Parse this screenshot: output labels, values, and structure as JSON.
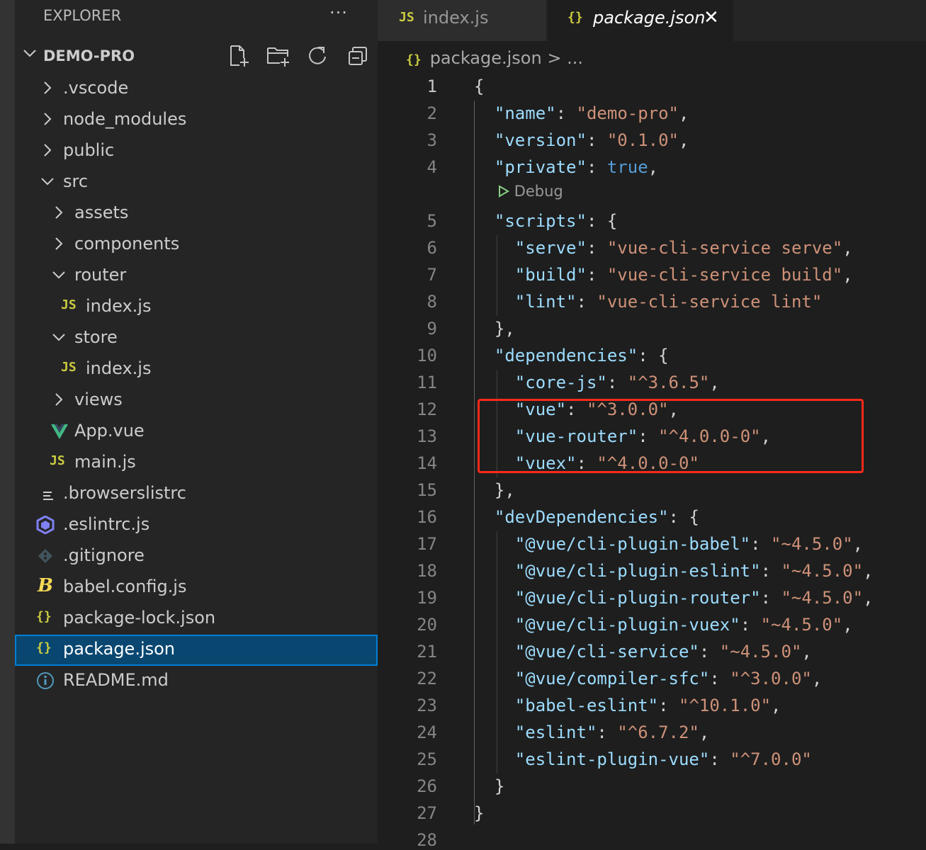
{
  "explorer": {
    "title": "EXPLORER",
    "more": "···",
    "root": "DEMO-PRO",
    "tree": [
      {
        "label": ".vscode",
        "type": "folder-collapsed",
        "depth": 1
      },
      {
        "label": "node_modules",
        "type": "folder-collapsed",
        "depth": 1
      },
      {
        "label": "public",
        "type": "folder-collapsed",
        "depth": 1
      },
      {
        "label": "src",
        "type": "folder-expanded",
        "depth": 1
      },
      {
        "label": "assets",
        "type": "folder-collapsed",
        "depth": 2
      },
      {
        "label": "components",
        "type": "folder-collapsed",
        "depth": 2
      },
      {
        "label": "router",
        "type": "folder-expanded",
        "depth": 2
      },
      {
        "label": "index.js",
        "type": "js",
        "depth": 3
      },
      {
        "label": "store",
        "type": "folder-expanded",
        "depth": 2
      },
      {
        "label": "index.js",
        "type": "js",
        "depth": 3
      },
      {
        "label": "views",
        "type": "folder-collapsed",
        "depth": 2
      },
      {
        "label": "App.vue",
        "type": "vue",
        "depth": 2
      },
      {
        "label": "main.js",
        "type": "js",
        "depth": 2
      },
      {
        "label": ".browserslistrc",
        "type": "list",
        "depth": 1
      },
      {
        "label": ".eslintrc.js",
        "type": "eslint",
        "depth": 1
      },
      {
        "label": ".gitignore",
        "type": "git",
        "depth": 1
      },
      {
        "label": "babel.config.js",
        "type": "babel",
        "depth": 1
      },
      {
        "label": "package-lock.json",
        "type": "json",
        "depth": 1
      },
      {
        "label": "package.json",
        "type": "json",
        "depth": 1,
        "selected": true
      },
      {
        "label": "README.md",
        "type": "info",
        "depth": 1
      }
    ]
  },
  "tabs": [
    {
      "icon": "JS",
      "label": "index.js",
      "active": false
    },
    {
      "icon": "{}",
      "label": "package.json",
      "active": true,
      "close": "✕"
    }
  ],
  "breadcrumb": {
    "icon": "{}",
    "file": "package.json",
    "sep": ">",
    "rest": "..."
  },
  "codelens": "Debug",
  "code": [
    {
      "n": "1",
      "t": [
        [
          "p",
          "{"
        ]
      ]
    },
    {
      "n": "2",
      "t": [
        [
          "p",
          "  "
        ],
        [
          "k",
          "\"name\""
        ],
        [
          "p",
          ": "
        ],
        [
          "s",
          "\"demo-pro\""
        ],
        [
          "p",
          ","
        ]
      ]
    },
    {
      "n": "3",
      "t": [
        [
          "p",
          "  "
        ],
        [
          "k",
          "\"version\""
        ],
        [
          "p",
          ": "
        ],
        [
          "s",
          "\"0.1.0\""
        ],
        [
          "p",
          ","
        ]
      ]
    },
    {
      "n": "4",
      "t": [
        [
          "p",
          "  "
        ],
        [
          "k",
          "\"private\""
        ],
        [
          "p",
          ": "
        ],
        [
          "b",
          "true"
        ],
        [
          "p",
          ","
        ]
      ]
    },
    {
      "n": "5",
      "t": [
        [
          "p",
          "  "
        ],
        [
          "k",
          "\"scripts\""
        ],
        [
          "p",
          ": {"
        ]
      ]
    },
    {
      "n": "6",
      "t": [
        [
          "p",
          "    "
        ],
        [
          "k",
          "\"serve\""
        ],
        [
          "p",
          ": "
        ],
        [
          "s",
          "\"vue-cli-service serve\""
        ],
        [
          "p",
          ","
        ]
      ]
    },
    {
      "n": "7",
      "t": [
        [
          "p",
          "    "
        ],
        [
          "k",
          "\"build\""
        ],
        [
          "p",
          ": "
        ],
        [
          "s",
          "\"vue-cli-service build\""
        ],
        [
          "p",
          ","
        ]
      ]
    },
    {
      "n": "8",
      "t": [
        [
          "p",
          "    "
        ],
        [
          "k",
          "\"lint\""
        ],
        [
          "p",
          ": "
        ],
        [
          "s",
          "\"vue-cli-service lint\""
        ]
      ]
    },
    {
      "n": "9",
      "t": [
        [
          "p",
          "  },"
        ]
      ]
    },
    {
      "n": "10",
      "t": [
        [
          "p",
          "  "
        ],
        [
          "k",
          "\"dependencies\""
        ],
        [
          "p",
          ": {"
        ]
      ]
    },
    {
      "n": "11",
      "t": [
        [
          "p",
          "    "
        ],
        [
          "k",
          "\"core-js\""
        ],
        [
          "p",
          ": "
        ],
        [
          "s",
          "\"^3.6.5\""
        ],
        [
          "p",
          ","
        ]
      ]
    },
    {
      "n": "12",
      "t": [
        [
          "p",
          "    "
        ],
        [
          "k",
          "\"vue\""
        ],
        [
          "p",
          ": "
        ],
        [
          "s",
          "\"^3.0.0\""
        ],
        [
          "p",
          ","
        ]
      ]
    },
    {
      "n": "13",
      "t": [
        [
          "p",
          "    "
        ],
        [
          "k",
          "\"vue-router\""
        ],
        [
          "p",
          ": "
        ],
        [
          "s",
          "\"^4.0.0-0\""
        ],
        [
          "p",
          ","
        ]
      ]
    },
    {
      "n": "14",
      "t": [
        [
          "p",
          "    "
        ],
        [
          "k",
          "\"vuex\""
        ],
        [
          "p",
          ": "
        ],
        [
          "s",
          "\"^4.0.0-0\""
        ]
      ]
    },
    {
      "n": "15",
      "t": [
        [
          "p",
          "  },"
        ]
      ]
    },
    {
      "n": "16",
      "t": [
        [
          "p",
          "  "
        ],
        [
          "k",
          "\"devDependencies\""
        ],
        [
          "p",
          ": {"
        ]
      ]
    },
    {
      "n": "17",
      "t": [
        [
          "p",
          "    "
        ],
        [
          "k",
          "\"@vue/cli-plugin-babel\""
        ],
        [
          "p",
          ": "
        ],
        [
          "s",
          "\"~4.5.0\""
        ],
        [
          "p",
          ","
        ]
      ]
    },
    {
      "n": "18",
      "t": [
        [
          "p",
          "    "
        ],
        [
          "k",
          "\"@vue/cli-plugin-eslint\""
        ],
        [
          "p",
          ": "
        ],
        [
          "s",
          "\"~4.5.0\""
        ],
        [
          "p",
          ","
        ]
      ]
    },
    {
      "n": "19",
      "t": [
        [
          "p",
          "    "
        ],
        [
          "k",
          "\"@vue/cli-plugin-router\""
        ],
        [
          "p",
          ": "
        ],
        [
          "s",
          "\"~4.5.0\""
        ],
        [
          "p",
          ","
        ]
      ]
    },
    {
      "n": "20",
      "t": [
        [
          "p",
          "    "
        ],
        [
          "k",
          "\"@vue/cli-plugin-vuex\""
        ],
        [
          "p",
          ": "
        ],
        [
          "s",
          "\"~4.5.0\""
        ],
        [
          "p",
          ","
        ]
      ]
    },
    {
      "n": "21",
      "t": [
        [
          "p",
          "    "
        ],
        [
          "k",
          "\"@vue/cli-service\""
        ],
        [
          "p",
          ": "
        ],
        [
          "s",
          "\"~4.5.0\""
        ],
        [
          "p",
          ","
        ]
      ]
    },
    {
      "n": "22",
      "t": [
        [
          "p",
          "    "
        ],
        [
          "k",
          "\"@vue/compiler-sfc\""
        ],
        [
          "p",
          ": "
        ],
        [
          "s",
          "\"^3.0.0\""
        ],
        [
          "p",
          ","
        ]
      ]
    },
    {
      "n": "23",
      "t": [
        [
          "p",
          "    "
        ],
        [
          "k",
          "\"babel-eslint\""
        ],
        [
          "p",
          ": "
        ],
        [
          "s",
          "\"^10.1.0\""
        ],
        [
          "p",
          ","
        ]
      ]
    },
    {
      "n": "24",
      "t": [
        [
          "p",
          "    "
        ],
        [
          "k",
          "\"eslint\""
        ],
        [
          "p",
          ": "
        ],
        [
          "s",
          "\"^6.7.2\""
        ],
        [
          "p",
          ","
        ]
      ]
    },
    {
      "n": "25",
      "t": [
        [
          "p",
          "    "
        ],
        [
          "k",
          "\"eslint-plugin-vue\""
        ],
        [
          "p",
          ": "
        ],
        [
          "s",
          "\"^7.0.0\""
        ]
      ]
    },
    {
      "n": "26",
      "t": [
        [
          "p",
          "  }"
        ]
      ]
    },
    {
      "n": "27",
      "t": [
        [
          "p",
          "}"
        ]
      ]
    },
    {
      "n": "28",
      "t": []
    }
  ]
}
